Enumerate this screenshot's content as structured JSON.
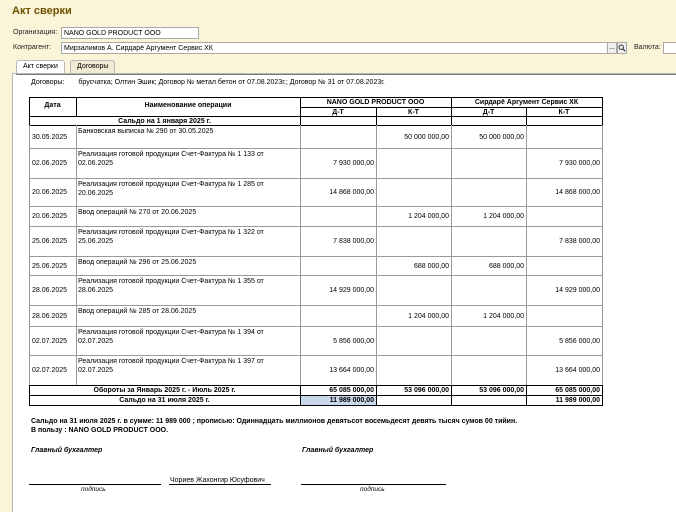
{
  "window": {
    "title": "Акт сверки"
  },
  "form": {
    "org_label": "Организация:",
    "org_value": "NANO GOLD PRODUCT ООО",
    "contractor_label": "Контрагент:",
    "contractor_value": "Мирзалимов А. Сирдарё Аргумент Сервис ХК",
    "ellipsis_btn": "...",
    "currency_label": "Валюта:"
  },
  "tabs": [
    {
      "label": "Акт сверки",
      "active": true
    },
    {
      "label": "Договоры",
      "active": false
    }
  ],
  "report": {
    "contracts_label": "Договоры:",
    "contracts_value": "брусчатка; Олтин Эшик; Договор № метал бетон от 07.08.2023г.; Договор № 31 от 07.08.2023г.",
    "headers": {
      "date": "Дата",
      "operation": "Наименование  операции",
      "company1": "NANO GOLD PRODUCT ООО",
      "company2": "Сирдарё Аргумент Сервис ХК",
      "dt": "Д-Т",
      "kt": "К-Т"
    },
    "opening_balance": "Сальдо на  1 января 2025 г.",
    "rows": [
      {
        "date": "30.05.2025",
        "op": "Банковская выписка № 290 от 30.05.2025",
        "d1": "",
        "k1": "50 000 000,00",
        "d2": "50 000 000,00",
        "k2": ""
      },
      {
        "date": "02.06.2025",
        "op": "Реализация готовой продукции Счет-Фактура № 1 133 от 02.06.2025",
        "d1": "7 930 000,00",
        "k1": "",
        "d2": "",
        "k2": "7 930 000,00"
      },
      {
        "date": "20.06.2025",
        "op": "Реализация готовой продукции Счет-Фактура № 1 285 от 20.06.2025",
        "d1": "14 868 000,00",
        "k1": "",
        "d2": "",
        "k2": "14 868 000,00"
      },
      {
        "date": "20.06.2025",
        "op": "Ввод операций № 270 от 20.06.2025",
        "d1": "",
        "k1": "1 204 000,00",
        "d2": "1 204 000,00",
        "k2": ""
      },
      {
        "date": "25.06.2025",
        "op": "Реализация готовой продукции Счет-Фактура № 1 322 от 25.06.2025",
        "d1": "7 838 000,00",
        "k1": "",
        "d2": "",
        "k2": "7 838 000,00"
      },
      {
        "date": "25.06.2025",
        "op": "Ввод операций № 296 от 25.06.2025",
        "d1": "",
        "k1": "688 000,00",
        "d2": "688 000,00",
        "k2": ""
      },
      {
        "date": "28.06.2025",
        "op": "Реализация готовой продукции Счет-Фактура № 1 355 от 28.06.2025",
        "d1": "14 929 000,00",
        "k1": "",
        "d2": "",
        "k2": "14 929 000,00"
      },
      {
        "date": "28.06.2025",
        "op": "Ввод операций № 285 от 28.06.2025",
        "d1": "",
        "k1": "1 204 000,00",
        "d2": "1 204 000,00",
        "k2": ""
      },
      {
        "date": "02.07.2025",
        "op": "Реализация готовой продукции Счет-Фактура № 1 394 от 02.07.2025",
        "d1": "5 856 000,00",
        "k1": "",
        "d2": "",
        "k2": "5 856 000,00"
      },
      {
        "date": "02.07.2025",
        "op": "Реализация готовой продукции Счет-Фактура № 1 397 от 02.07.2025",
        "d1": "13 664 000,00",
        "k1": "",
        "d2": "",
        "k2": "13 664 000,00"
      }
    ],
    "turnover": {
      "label": "Обороты за Январь 2025 г. - Июль 2025 г.",
      "d1": "65 085 000,00",
      "k1": "53 096 000,00",
      "d2": "53 096 000,00",
      "k2": "65 085 000,00"
    },
    "closing": {
      "label": "Сальдо на  31 июля 2025 г.",
      "d1": "11 989 000,00",
      "k2": "11 989 000,00"
    },
    "summary_line1": "Сальдо на 31 июля 2025 г.   в  сумме: 11 989 000 ; прописью: Одиннадцать миллионов девятьсот восемьдесят девять тысяч сумов 00 тийин.",
    "summary_line2": "В пользу : NANO GOLD PRODUCT ООО.",
    "signatures": {
      "left_title": "Главный бухгалтер",
      "right_title": "Главный бухгалтер",
      "left_name": "Чориев Жахонгир Юсуфович",
      "caption": "подпись"
    }
  }
}
